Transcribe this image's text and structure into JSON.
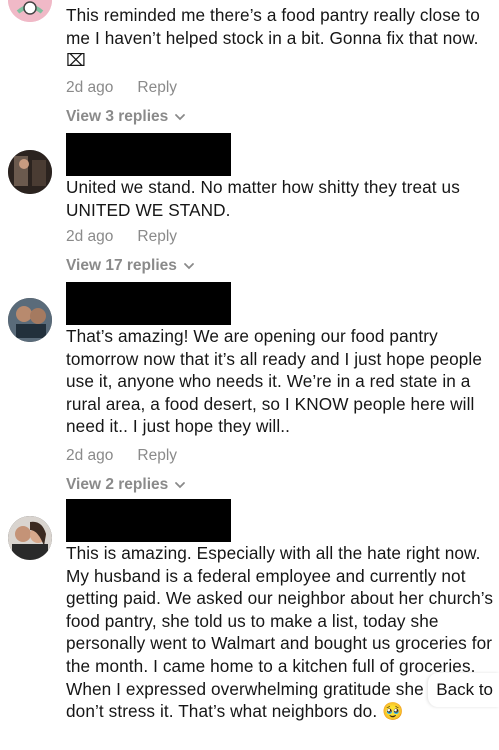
{
  "comments": [
    {
      "text": "This reminded me there’s a food pantry really close to me I haven’t helped stock in a bit. Gonna fix that now. ⌧",
      "age": "2d ago",
      "reply_label": "Reply",
      "view_replies": "View 3 replies"
    },
    {
      "text": "United we stand. No matter how shitty they treat us UNITED WE STAND.",
      "age": "2d ago",
      "reply_label": "Reply",
      "view_replies": "View 17 replies"
    },
    {
      "text": "That’s amazing! We are opening our food pantry tomorrow now that it’s all ready and I just hope people use it, anyone who needs it. We’re in a red state in a rural area, a food desert, so I KNOW people here will need it.. I just hope they will..",
      "age": "2d ago",
      "reply_label": "Reply",
      "view_replies": "View 2 replies"
    },
    {
      "text": "This is amazing. Especially with all the hate right now. My husband is a federal employee and currently not getting paid. We asked our neighbor about her church’s food pantry, she told us to make a list, today she personally went to Walmart and bought us groceries for the month. I came home to a kitchen full of groceries. When I expressed overwhelming gratitude she said don’t stress it. That’s what neighbors do. 🥹"
    }
  ],
  "back_button": "Back to",
  "colors": {
    "meta": "#8a8a8a",
    "text": "#161616",
    "redaction": "#000000"
  }
}
